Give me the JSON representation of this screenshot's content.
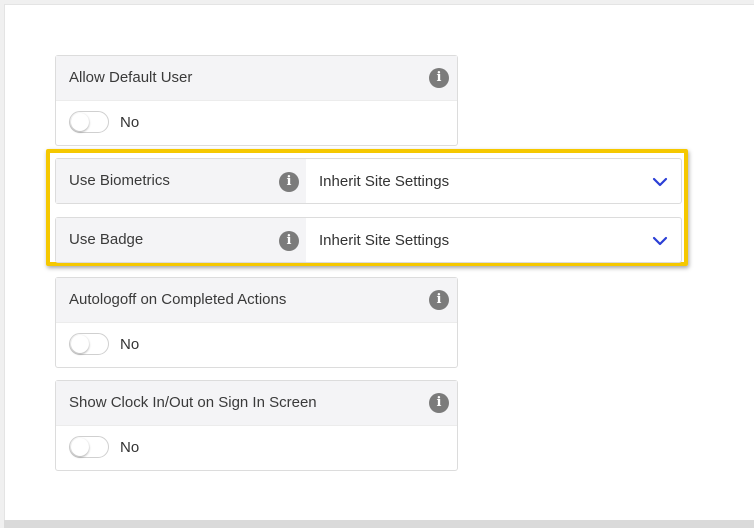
{
  "settings": {
    "allow_default_user": {
      "title": "Allow Default User",
      "value_label": "No",
      "enabled": false
    },
    "use_biometrics": {
      "title": "Use Biometrics",
      "selected": "Inherit Site Settings"
    },
    "use_badge": {
      "title": "Use Badge",
      "selected": "Inherit Site Settings"
    },
    "autologoff": {
      "title": "Autologoff on Completed Actions",
      "value_label": "No",
      "enabled": false
    },
    "show_clock": {
      "title": "Show Clock In/Out on Sign In Screen",
      "value_label": "No",
      "enabled": false
    }
  },
  "icons": {
    "info": "info-icon",
    "dropdown": "chevron-down-icon"
  },
  "colors": {
    "highlight": "#f5c800",
    "chevron": "#2b3fd6",
    "info_icon": "#7b7b7b"
  }
}
